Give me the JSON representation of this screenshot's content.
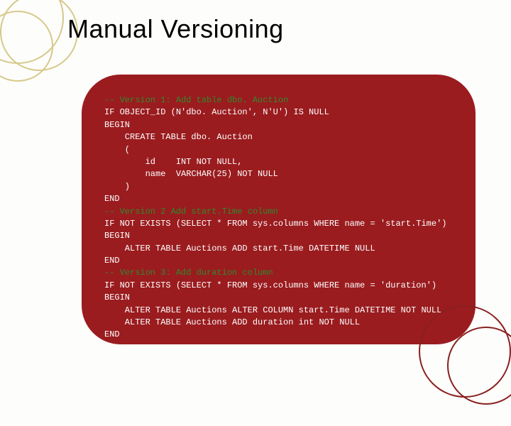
{
  "title": "Manual Versioning",
  "code": {
    "c1": "-- Version 1: Add table dbo. Auction",
    "l2": "IF OBJECT_ID (N'dbo. Auction', N'U') IS NULL",
    "l3": "BEGIN",
    "l4": "    CREATE TABLE dbo. Auction",
    "l5": "    (",
    "l6": "        id    INT NOT NULL,",
    "l7": "        name  VARCHAR(25) NOT NULL",
    "l8": "    )",
    "l9": "END",
    "c2": "-- Version 2 Add start.Time column",
    "l11": "IF NOT EXISTS (SELECT * FROM sys.columns WHERE name = 'start.Time')",
    "l12": "BEGIN",
    "l13": "    ALTER TABLE Auctions ADD start.Time DATETIME NULL",
    "l14": "END",
    "c3": "-- Version 3: Add duration column",
    "l16": "IF NOT EXISTS (SELECT * FROM sys.columns WHERE name = 'duration')",
    "l17": "BEGIN",
    "l18": "    ALTER TABLE Auctions ALTER COLUMN start.Time DATETIME NOT NULL",
    "l19": "    ALTER TABLE Auctions ADD duration int NOT NULL",
    "l20": "END"
  }
}
